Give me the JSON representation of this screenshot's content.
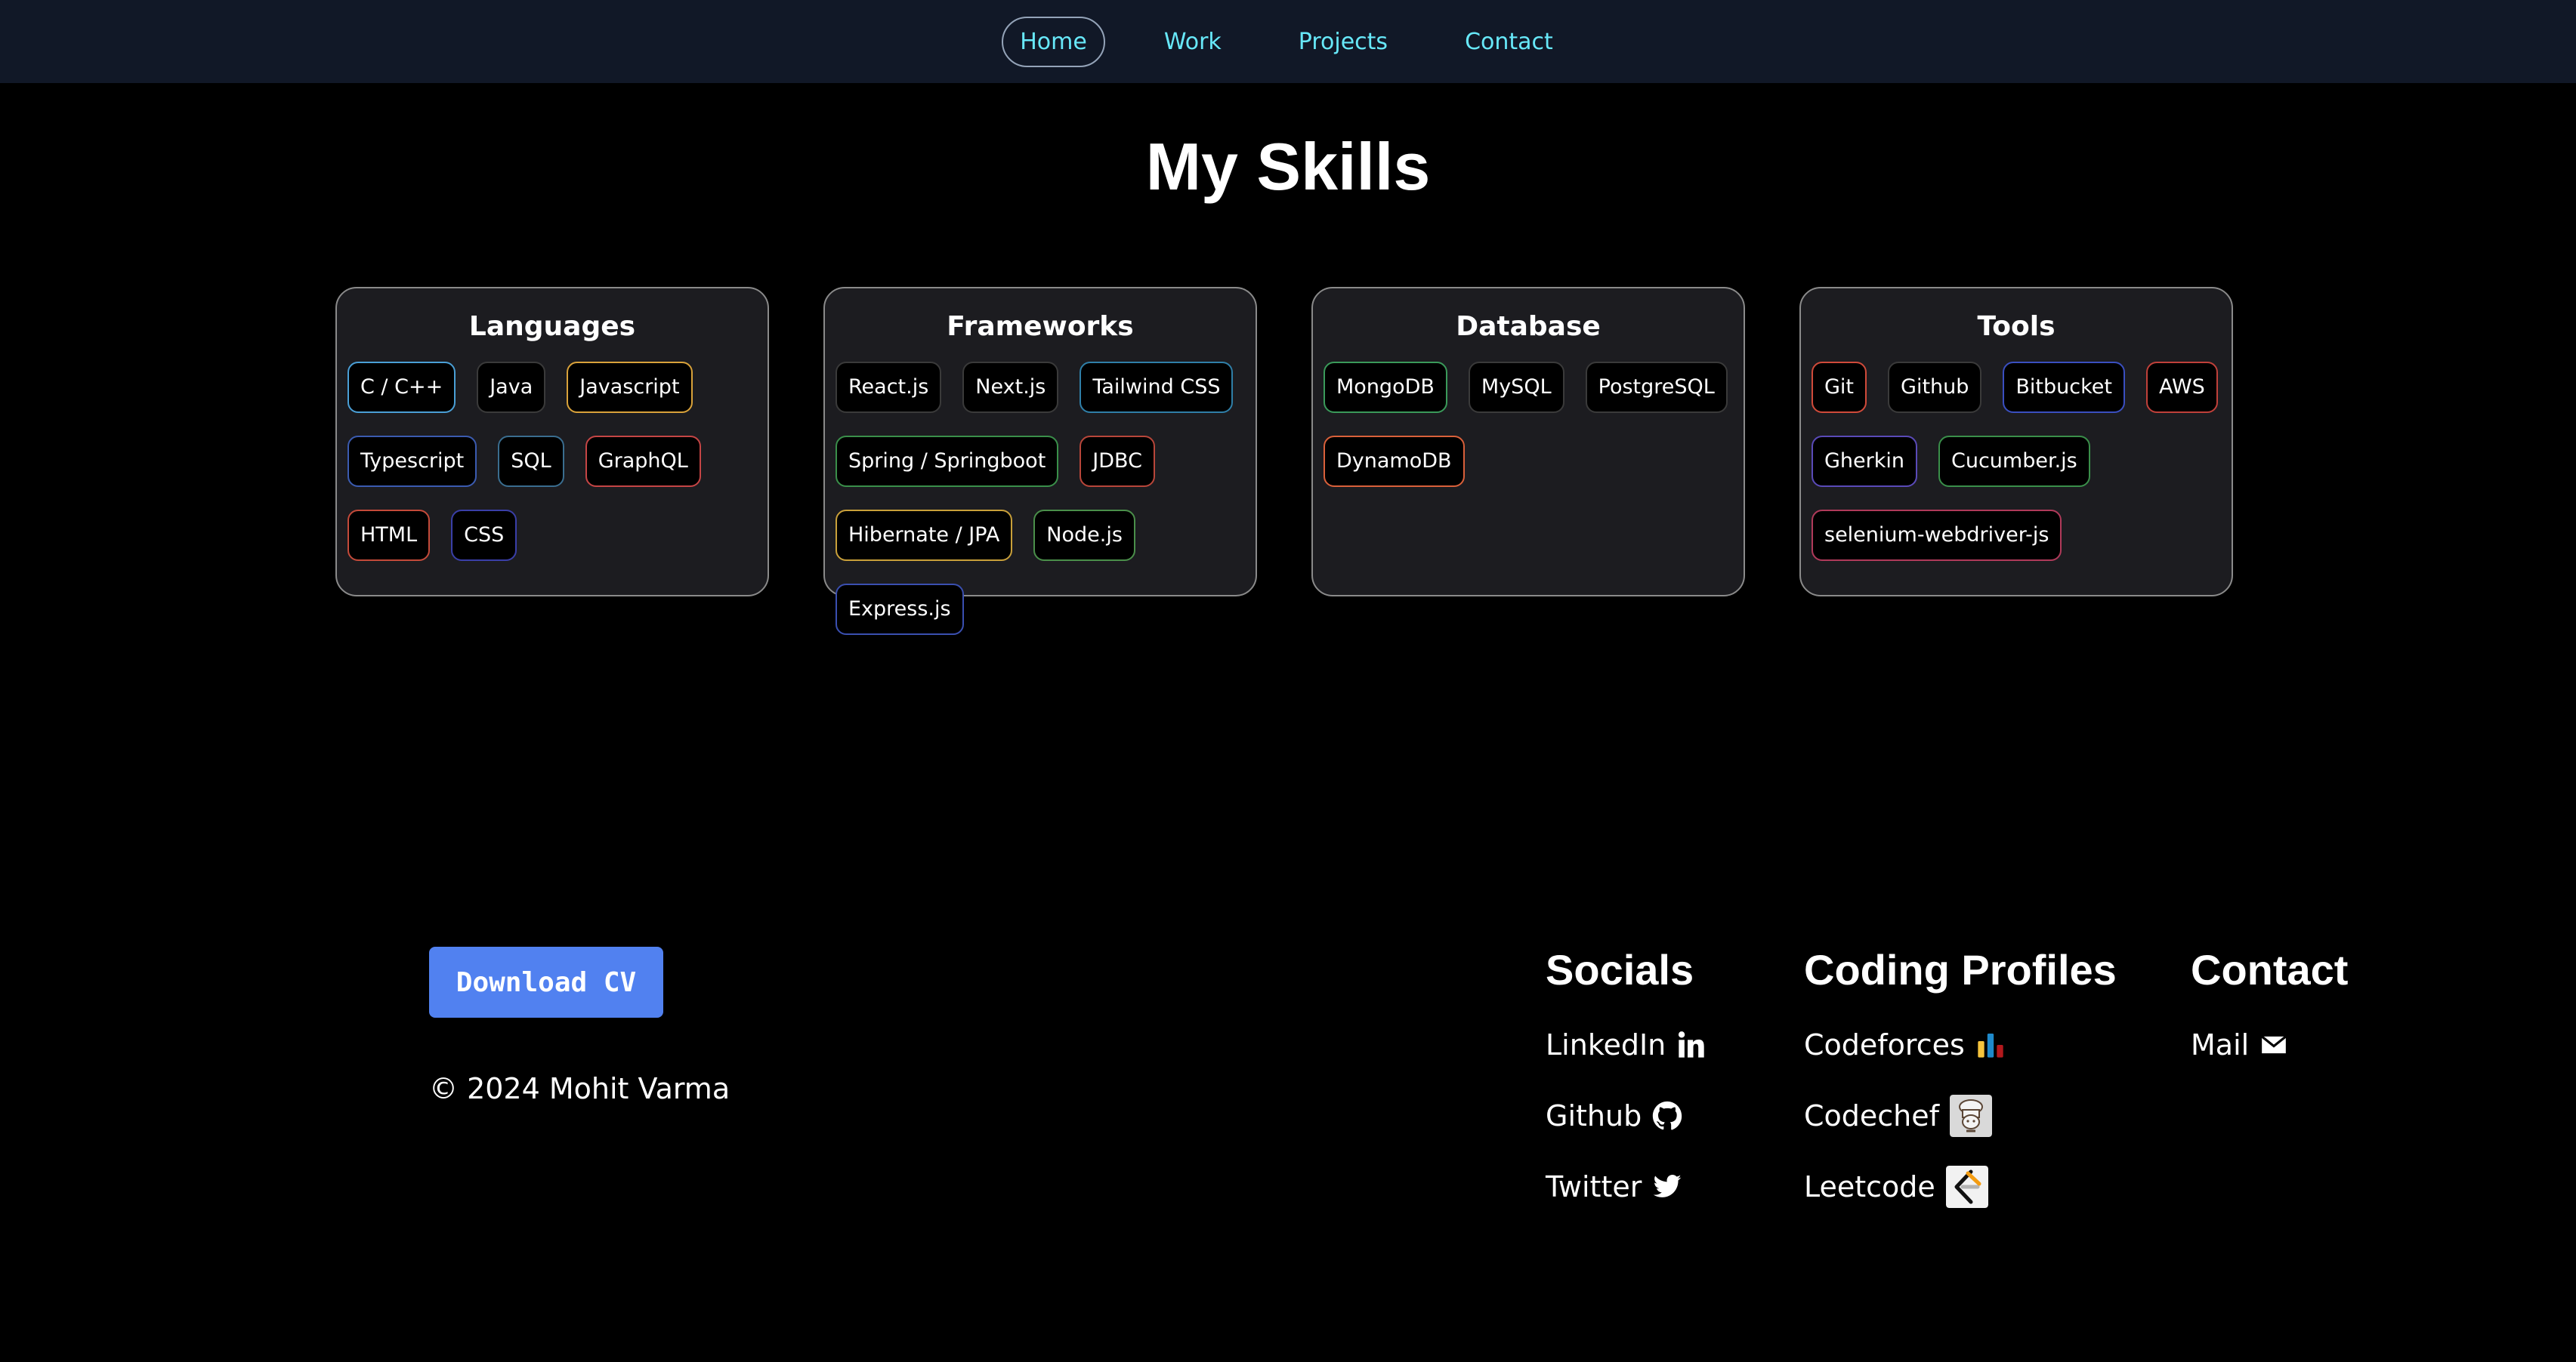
{
  "nav": {
    "items": [
      {
        "label": "Home",
        "active": true
      },
      {
        "label": "Work"
      },
      {
        "label": "Projects"
      },
      {
        "label": "Contact"
      }
    ]
  },
  "page_title": "My Skills",
  "skills": [
    {
      "title": "Languages",
      "chips": [
        {
          "label": "C / C++",
          "color": "#4a9fd6"
        },
        {
          "label": "Java",
          "color": "#3a3a3a"
        },
        {
          "label": "Javascript",
          "color": "#d9a23a"
        },
        {
          "label": "Typescript",
          "color": "#3b5bb0"
        },
        {
          "label": "SQL",
          "color": "#3a6d8f"
        },
        {
          "label": "GraphQL",
          "color": "#c54545"
        },
        {
          "label": "HTML",
          "color": "#c44a3a"
        },
        {
          "label": "CSS",
          "color": "#3a3fa8"
        }
      ]
    },
    {
      "title": "Frameworks",
      "chips": [
        {
          "label": "React.js",
          "color": "#3a3a3a"
        },
        {
          "label": "Next.js",
          "color": "#3a3a3a"
        },
        {
          "label": "Tailwind CSS",
          "color": "#2f7fa8"
        },
        {
          "label": "Spring / Springboot",
          "color": "#3a8f4a"
        },
        {
          "label": "JDBC",
          "color": "#b8463a"
        },
        {
          "label": "Hibernate / JPA",
          "color": "#c9a03a"
        },
        {
          "label": "Node.js",
          "color": "#4a8f4a"
        },
        {
          "label": "Express.js",
          "color": "#3a4fb0"
        }
      ]
    },
    {
      "title": "Database",
      "chips": [
        {
          "label": "MongoDB",
          "color": "#3a9a5a"
        },
        {
          "label": "MySQL",
          "color": "#3a3a3a"
        },
        {
          "label": "PostgreSQL",
          "color": "#3a3a3a"
        },
        {
          "label": "DynamoDB",
          "color": "#d9603a"
        }
      ]
    },
    {
      "title": "Tools",
      "chips": [
        {
          "label": "Git",
          "color": "#d04a3a"
        },
        {
          "label": "Github",
          "color": "#3a3a3a"
        },
        {
          "label": "Bitbucket",
          "color": "#3a4fc0"
        },
        {
          "label": "AWS",
          "color": "#c0403a"
        },
        {
          "label": "Gherkin",
          "color": "#5a4ab8"
        },
        {
          "label": "Cucumber.js",
          "color": "#3a8f4a"
        },
        {
          "label": "selenium-webdriver-js",
          "color": "#b03a5a"
        }
      ]
    }
  ],
  "footer": {
    "download_label": "Download CV",
    "copyright": "© 2024 Mohit Varma",
    "socials": {
      "heading": "Socials",
      "items": [
        {
          "label": "LinkedIn",
          "icon": "linkedin-icon"
        },
        {
          "label": "Github",
          "icon": "github-icon"
        },
        {
          "label": "Twitter",
          "icon": "twitter-icon"
        }
      ]
    },
    "coding_profiles": {
      "heading": "Coding Profiles",
      "items": [
        {
          "label": "Codeforces",
          "icon": "codeforces-icon"
        },
        {
          "label": "Codechef",
          "icon": "codechef-icon"
        },
        {
          "label": "Leetcode",
          "icon": "leetcode-icon"
        }
      ]
    },
    "contact": {
      "heading": "Contact",
      "items": [
        {
          "label": "Mail",
          "icon": "mail-icon"
        }
      ]
    }
  },
  "colors": {
    "nav_bg": "#111827",
    "nav_link": "#67e8f9",
    "card_bg": "#1c1c20",
    "button_bg": "#5181f0"
  }
}
